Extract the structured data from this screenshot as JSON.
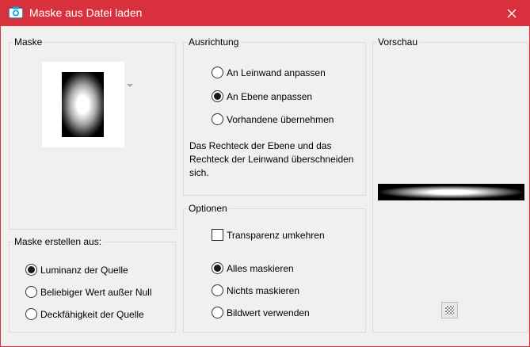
{
  "window": {
    "title": "Maske aus Datei laden",
    "title_bar_color": "#d8303d"
  },
  "maske": {
    "label": "Maske"
  },
  "erstellen": {
    "label": "Maske erstellen aus:",
    "options": [
      {
        "label": "Luminanz der Quelle",
        "selected": true
      },
      {
        "label": "Beliebiger Wert außer Null",
        "selected": false
      },
      {
        "label": "Deckfähigkeit der Quelle",
        "selected": false
      }
    ]
  },
  "ausrichtung": {
    "label": "Ausrichtung",
    "options": [
      {
        "label": "An Leinwand anpassen",
        "selected": false
      },
      {
        "label": "An Ebene anpassen",
        "selected": true
      },
      {
        "label": "Vorhandene übernehmen",
        "selected": false
      }
    ],
    "description": "Das Rechteck der Ebene und das Rechteck der Leinwand überschneiden sich."
  },
  "optionen": {
    "label": "Optionen",
    "invert_checkbox": {
      "label": "Transparenz umkehren",
      "checked": false
    },
    "options": [
      {
        "label": "Alles maskieren",
        "selected": true
      },
      {
        "label": "Nichts maskieren",
        "selected": false
      },
      {
        "label": "Bildwert verwenden",
        "selected": false
      }
    ]
  },
  "vorschau": {
    "label": "Vorschau"
  },
  "icons": {
    "app": "camera-icon",
    "close": "close-icon",
    "transparency": "checkerboard-icon"
  }
}
